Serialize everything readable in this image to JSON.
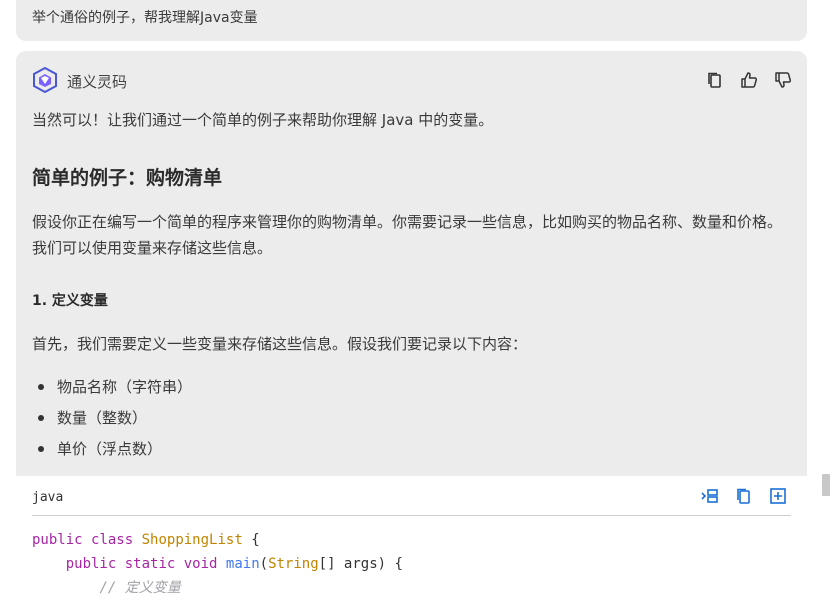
{
  "user_message": "举个通俗的例子，帮我理解Java变量",
  "assistant": {
    "name": "通义灵码",
    "intro": "当然可以！让我们通过一个简单的例子来帮助你理解 Java 中的变量。",
    "heading": "简单的例子：购物清单",
    "paragraph": "假设你正在编写一个简单的程序来管理你的购物清单。你需要记录一些信息，比如购买的物品名称、数量和价格。我们可以使用变量来存储这些信息。",
    "section_title": "1. 定义变量",
    "section_text": "首先，我们需要定义一些变量来存储这些信息。假设我们要记录以下内容：",
    "bullets": [
      "物品名称（字符串）",
      "数量（整数）",
      "单价（浮点数）"
    ]
  },
  "actions": {
    "copy_icon": "copy-icon",
    "like_icon": "thumbs-up-icon",
    "dislike_icon": "thumbs-down-icon"
  },
  "code_block": {
    "language": "java",
    "line1": {
      "kw1": "public",
      "kw2": "class",
      "cls": "ShoppingList",
      "rest": "{"
    },
    "line2": {
      "kw1": "public",
      "kw2": "static",
      "kw3": "void",
      "fn": "main",
      "paren_open": "(",
      "type": "String",
      "rest": "[] args) {"
    },
    "line3": {
      "comment": "// 定义变量"
    }
  },
  "colors": {
    "card_bg": "#ececec",
    "accent": "#4a57d6",
    "keyword": "#a626a4",
    "class": "#c18401",
    "function": "#4078f2",
    "comment": "#a0a1a7"
  }
}
